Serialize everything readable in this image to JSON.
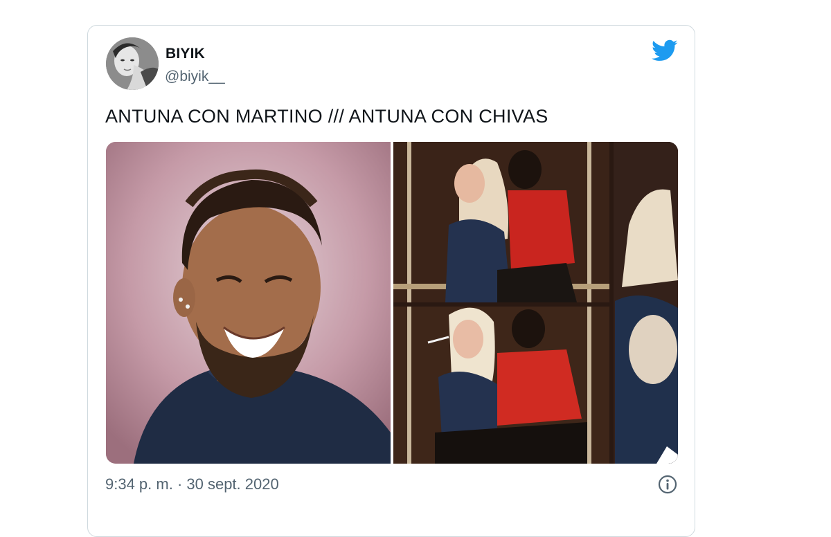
{
  "tweet": {
    "display_name": "BIYIK",
    "handle": "@biyik__",
    "text": "ANTUNA CON MARTINO /// ANTUNA CON CHIVAS",
    "timestamp": "9:34 p. m. · 30 sept. 2020"
  },
  "icons": {
    "brand": "twitter-bird-icon",
    "info": "info-icon"
  },
  "colors": {
    "twitter_blue": "#1d9bf0",
    "text_primary": "#0f1419",
    "text_secondary": "#536471",
    "border": "#cfd9de"
  }
}
